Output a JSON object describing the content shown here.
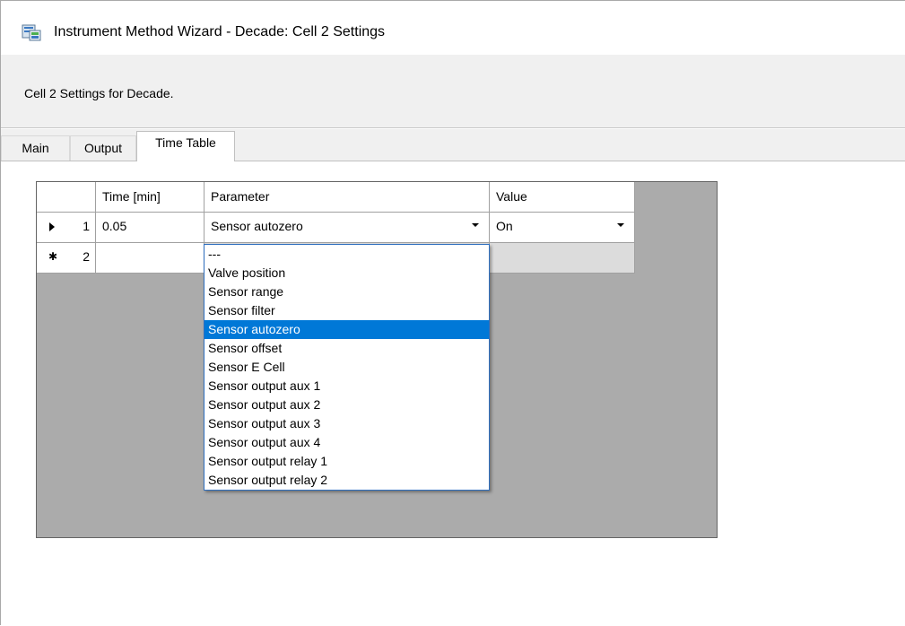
{
  "window": {
    "title": "Instrument Method Wizard - Decade: Cell 2 Settings",
    "icon": "wizard-app-icon"
  },
  "header": {
    "description": "Cell 2 Settings for Decade."
  },
  "tabs": [
    {
      "label": "Main",
      "active": false
    },
    {
      "label": "Output",
      "active": false
    },
    {
      "label": "Time Table",
      "active": true
    }
  ],
  "table": {
    "columns": [
      "Time [min]",
      "Parameter",
      "Value"
    ],
    "rows": [
      {
        "indicator": "current-row-arrow",
        "num": "1",
        "time": "0.05",
        "parameter": "Sensor autozero",
        "value": "On"
      },
      {
        "indicator": "new-row-asterisk",
        "num": "2",
        "time": "",
        "parameter": "",
        "value": ""
      }
    ]
  },
  "dropdown": {
    "selected": "Sensor autozero",
    "options": [
      "---",
      "Valve position",
      "Sensor range",
      "Sensor filter",
      "Sensor autozero",
      "Sensor offset",
      "Sensor E Cell",
      "Sensor output aux 1",
      "Sensor output aux 2",
      "Sensor output aux 3",
      "Sensor output aux 4",
      "Sensor output relay 1",
      "Sensor output relay 2"
    ]
  },
  "colors": {
    "selection": "#0078d7",
    "grid_background": "#ababab",
    "header_panel": "#f0f0f0"
  }
}
